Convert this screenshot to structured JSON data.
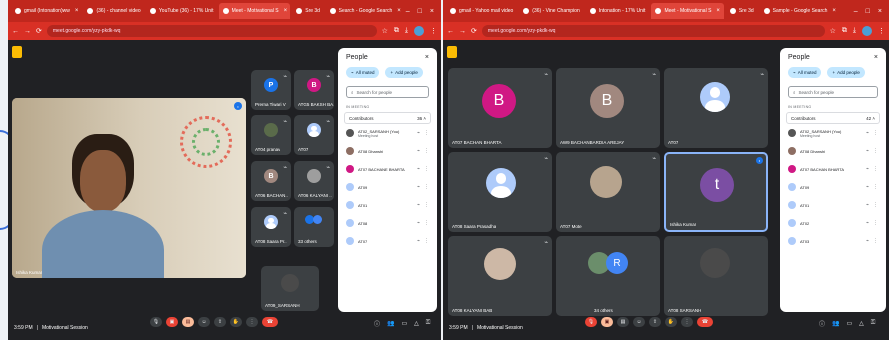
{
  "colors": {
    "red_bar": "#c0271d",
    "meet_bg": "#202124",
    "tile_bg": "#3c4043",
    "accent_blue": "#c2e7ff",
    "hangup": "#ea4335"
  },
  "left": {
    "tabs": [
      {
        "label": "gmail (Intonation)ww"
      },
      {
        "label": "(36) - channel video"
      },
      {
        "label": "YouTube (36) - 17% Unit"
      },
      {
        "label": "Meet - Motivational S"
      },
      {
        "label": "Sre 3d"
      }
    ],
    "search_tab": "Search - Google Search",
    "url": "meet.google.com/yzy-pkdk-wq",
    "main_name": "Ishika Kumar",
    "tiles": [
      {
        "name": "Prerna Tiwari V",
        "letter": "P",
        "color": "#1a73e8"
      },
      {
        "name": "ATG5 BAKSH BA..",
        "letter": "B",
        "color": "#d01884"
      },
      {
        "name": "AT04 pranav",
        "letter": "",
        "color": ""
      },
      {
        "name": "AT07",
        "letter": "",
        "color": ""
      },
      {
        "name": "AT06 BACHAN..",
        "letter": "B",
        "color": "#a1887f"
      },
      {
        "name": "AT06 KALYANI ..",
        "letter": "",
        "color": ""
      },
      {
        "name": "AT08 Saara Pr..",
        "letter": "",
        "color": ""
      },
      {
        "name": "33 others",
        "letter": "",
        "color": ""
      },
      {
        "name": "AT09_SARSANH",
        "letter": "",
        "color": ""
      }
    ],
    "time": "3:59 PM",
    "meeting": "Motivational Session"
  },
  "right": {
    "tabs": [
      {
        "label": "gmail - Yahoo mail video"
      },
      {
        "label": "(36) - Vine Champion"
      },
      {
        "label": "Intonation - 17% Unit"
      },
      {
        "label": "Meet - Motivational S"
      },
      {
        "label": "Sre 3d"
      }
    ],
    "search_tab": "Sample - Google Search",
    "url": "meet.google.com/yzy-pkdk-wq",
    "tiles": [
      {
        "name": "AT07 BACHAN BHARTA",
        "letter": "B",
        "color": "#d01884"
      },
      {
        "name": "AW9 BACHANBARDIA AREJAY",
        "letter": "B",
        "color": "#a1887f"
      },
      {
        "name": "AT07",
        "letter": "",
        "color": ""
      },
      {
        "name": "AT08 Saara Prasadha",
        "letter": "",
        "color": ""
      },
      {
        "name": "AT07 Mote",
        "letter": "",
        "color": ""
      },
      {
        "name": "Ishika Kumar",
        "letter": "t",
        "color": "#7b4ea3"
      },
      {
        "name": "AT08 KALYANI BAB",
        "letter": "",
        "color": ""
      },
      {
        "name": "34 others",
        "letter": "R",
        "color": "#4285f4"
      },
      {
        "name": "AT08 SARSANH",
        "letter": "",
        "color": ""
      }
    ],
    "time": "3:59 PM",
    "meeting": "Motivational Session"
  },
  "people": {
    "title": "People",
    "all_muted": "All muted",
    "add_people": "Add people",
    "search_placeholder": "Search for people",
    "section": "IN MEETING",
    "contributors_label": "Contributors",
    "left_count": "36",
    "right_count": "42",
    "left_rows": [
      {
        "name": "AT02_SARSANH (You)",
        "sub": "Meeting host",
        "color": "#555"
      },
      {
        "name": "AT08 Dhanshi",
        "sub": "",
        "color": "#8d6e63"
      },
      {
        "name": "AT07 BACHANE BHARTA",
        "sub": "",
        "color": "#d01884"
      },
      {
        "name": "AT09",
        "sub": "",
        "color": "#aecbfa"
      },
      {
        "name": "AT01",
        "sub": "",
        "color": "#aecbfa"
      },
      {
        "name": "AT08",
        "sub": "",
        "color": "#aecbfa"
      },
      {
        "name": "AT07",
        "sub": "",
        "color": "#aecbfa"
      }
    ],
    "right_rows": [
      {
        "name": "AT02_SARSANH (You)",
        "sub": "Meeting host",
        "color": "#555"
      },
      {
        "name": "AT08 Dhanshi",
        "sub": "",
        "color": "#8d6e63"
      },
      {
        "name": "AT07 BACHAN BHARTA",
        "sub": "",
        "color": "#d01884"
      },
      {
        "name": "AT09",
        "sub": "",
        "color": "#aecbfa"
      },
      {
        "name": "AT01",
        "sub": "",
        "color": "#aecbfa"
      },
      {
        "name": "AT02",
        "sub": "",
        "color": "#aecbfa"
      },
      {
        "name": "AT03",
        "sub": "",
        "color": "#aecbfa"
      }
    ]
  }
}
